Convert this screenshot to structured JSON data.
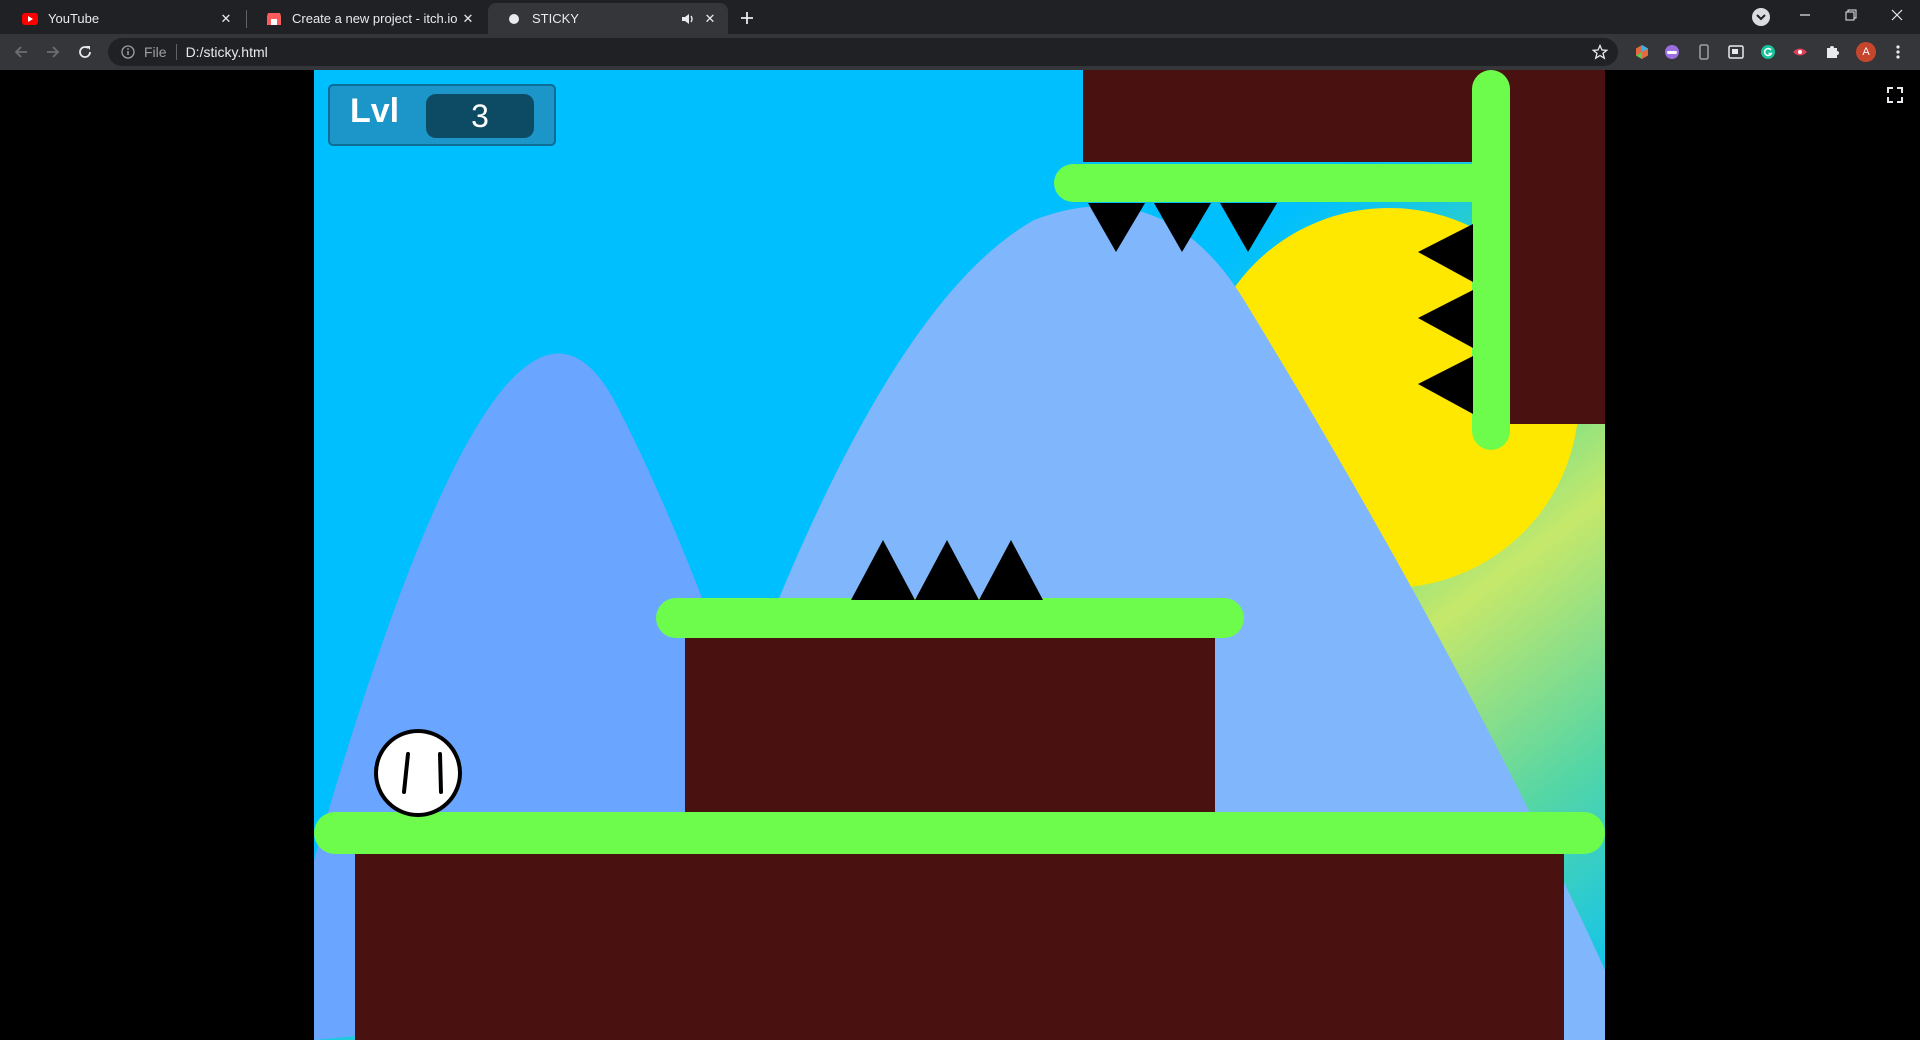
{
  "browser": {
    "tabs": [
      {
        "title": "YouTube",
        "favicon": "youtube-icon",
        "active": false
      },
      {
        "title": "Create a new project - itch.io",
        "favicon": "itchio-icon",
        "active": false
      },
      {
        "title": "STICKY",
        "favicon": "page-icon",
        "active": true,
        "audio": "speaker-icon"
      }
    ],
    "address": {
      "scheme_label": "File",
      "url": "D:/sticky.html"
    },
    "profile_initial": "A"
  },
  "game": {
    "hud": {
      "level_label": "Lvl",
      "level_value": "3"
    },
    "colors": {
      "sky": "#00bfff",
      "mountains": "#6fa8ff",
      "sun": "#ffe800",
      "platform_top": "#6dfc4b",
      "ground": "#4a1111",
      "spikes": "#000000",
      "player": "#ffffff"
    }
  }
}
